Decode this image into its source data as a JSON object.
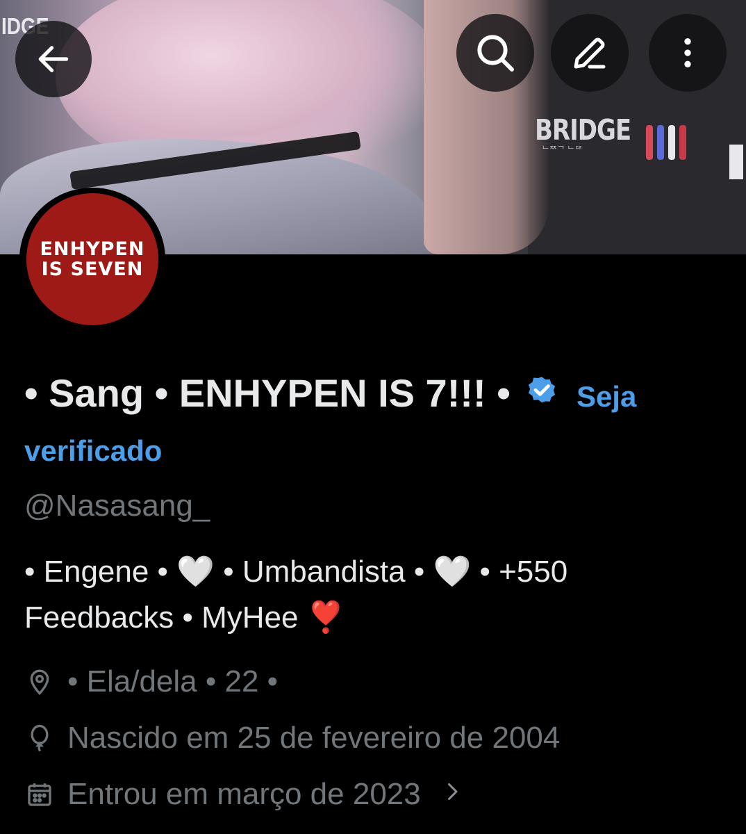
{
  "header": {
    "back_icon": "arrow-left-icon",
    "search_icon": "search-icon",
    "edit_icon": "pencil-icon",
    "more_icon": "more-vertical-icon",
    "banner_text_bridge": "BRIDGE",
    "banner_text_bridge_sub": "ᄂᄍᄀ ᄂᄃᄅ",
    "banner_text_corner": "IDGE"
  },
  "avatar": {
    "line1": "ENHYPEN",
    "line2": "IS SEVEN",
    "bg_color": "#9e1a16"
  },
  "profile": {
    "display_name": "• Sang • ENHYPEN IS 7!!! •",
    "verified_badge_icon": "verified-badge-icon",
    "verify_prompt": "Seja verificado",
    "handle": "@Nasasang_",
    "bio": "• Engene • 🤍 • Umbandista • 🤍 • +550 Feedbacks •  MyHee ❣️",
    "location": "• Ela/dela • 22 •",
    "birth": "Nascido em 25 de fevereiro de 2004",
    "joined": "Entrou em março de 2023"
  },
  "colors": {
    "background": "#000000",
    "text_primary": "#e7e9ea",
    "text_secondary": "#71767b",
    "accent_blue": "#4d9ee8"
  }
}
